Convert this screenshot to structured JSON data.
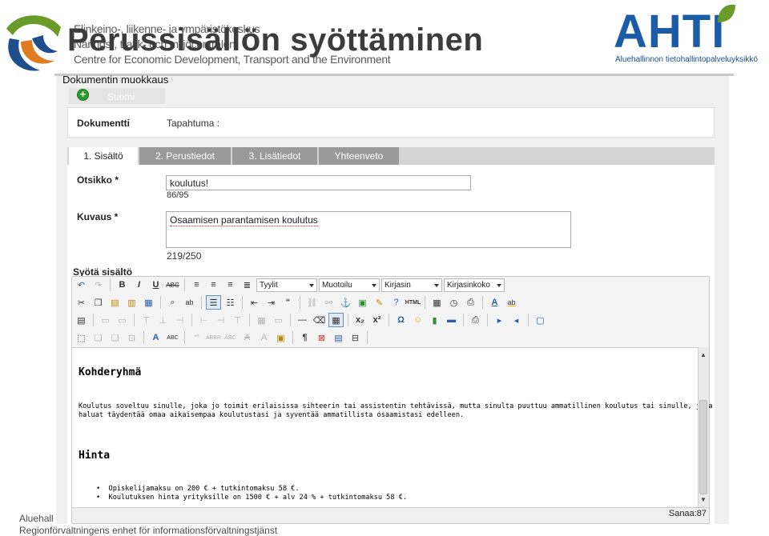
{
  "header": {
    "ely_lines": [
      "Elinkeino-, liikenne- ja ympäristökeskus",
      "Närings-, trafik- och miljöcentralen",
      "Centre for Economic Development, Transport and the Environment"
    ],
    "slide_title": "Perussisällön syöttäminen",
    "ahti_logo": "AHTI",
    "ahti_tagline": "Aluehallinnon tietohallintopalveluyksikkö"
  },
  "app": {
    "title": "Dokumentin muokkaus",
    "language_tab": "Suomi",
    "document_label": "Dokumentti",
    "document_value": "Tapahtuma :",
    "tabs": [
      {
        "label": "1. Sisältö",
        "active": true
      },
      {
        "label": "2. Perustiedot",
        "active": false
      },
      {
        "label": "3. Lisätiedot",
        "active": false
      },
      {
        "label": "Yhteenveto",
        "active": false
      }
    ],
    "form": {
      "title_label": "Otsikko *",
      "title_value": "koulutus!",
      "title_count": "86/95",
      "desc_label": "Kuvaus *",
      "desc_value": "Osaamisen parantamisen koulutus",
      "desc_count": "219/250",
      "content_label": "Syötä sisältö"
    },
    "toolbar": {
      "styles": "Tyylit",
      "format": "Muotoilu",
      "font": "Kirjasin",
      "size": "Kirjasinkoko"
    },
    "editor": {
      "heading1": "Kohderyhmä",
      "para1_line1": "Koulutus soveltuu sinulle, joka jo toimit erilaisissa sihteerin tai assistentin tehtävissä, mutta sinulta puuttuu ammatillinen koulutus tai sinulle, joka",
      "para1_line2": "haluat  täydentää omaa aikaisempaa koulutustasi ja syventää ammatillista osaamistasi edelleen.",
      "heading2": "Hinta",
      "bullets": [
        "Opiskelijamaksu on 200 € + tutkintomaksu 58 €.",
        "Koulutuksen hinta yrityksille on 1500 € + alv 24 % + tutkintomaksu 58 €."
      ],
      "word_count": "Sanaa:87"
    }
  },
  "footer": {
    "line1": "Aluehall",
    "line2": "Regionförvaltningens enhet för informationsförvaltningstjänst"
  },
  "colors": {
    "ahti_blue": "#1a5ca8",
    "ahti_green": "#6a9a2a",
    "tab_gray": "#9a9a9a"
  }
}
